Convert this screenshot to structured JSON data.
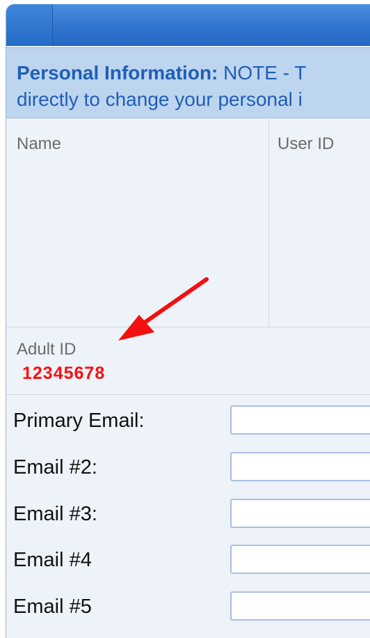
{
  "notice": {
    "label": "Personal Information:",
    "line1_text": " NOTE - T",
    "line2_text": "directly to change your personal i"
  },
  "fields": {
    "name_label": "Name",
    "user_id_label": "User ID",
    "adult_id_label": "Adult ID",
    "adult_id_value": "12345678"
  },
  "form": {
    "rows": [
      {
        "label": "Primary Email:",
        "value": ""
      },
      {
        "label": "Email #2:",
        "value": ""
      },
      {
        "label": "Email #3:",
        "value": ""
      },
      {
        "label": "Email #4",
        "value": ""
      },
      {
        "label": "Email #5",
        "value": ""
      }
    ]
  },
  "colors": {
    "header_blue": "#2f74cf",
    "notice_bg": "#bed5f0",
    "notice_text": "#1f5fb5",
    "highlight_red": "#ff0d0d"
  }
}
